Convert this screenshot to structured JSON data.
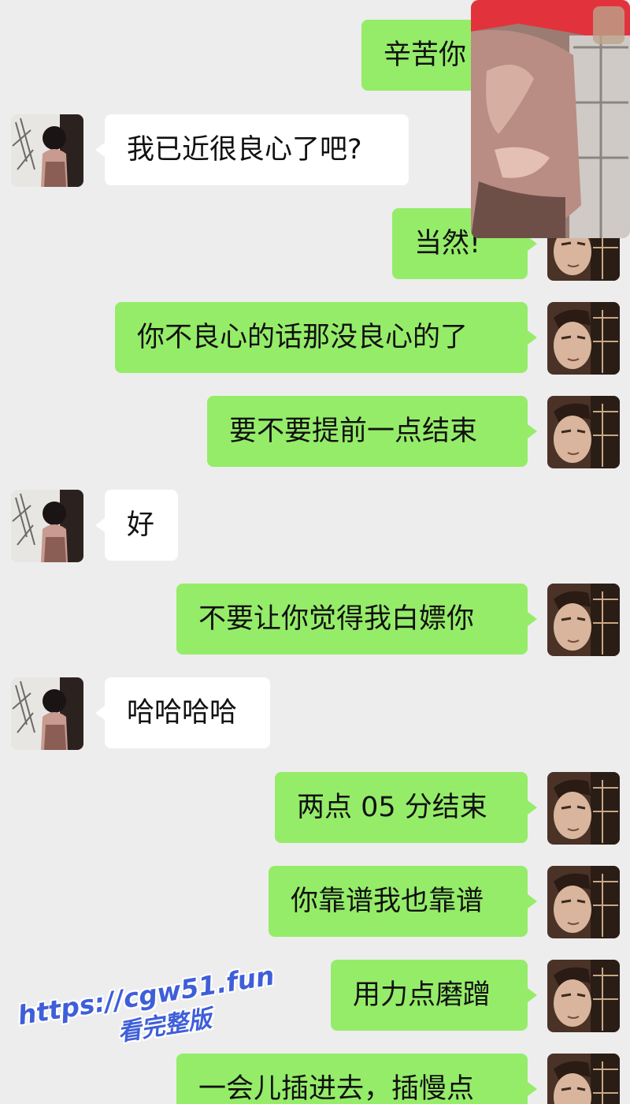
{
  "messages": [
    {
      "sender": "self",
      "text": "辛苦你"
    },
    {
      "sender": "other",
      "text": "我已近很良心了吧?"
    },
    {
      "sender": "self",
      "text": "当然!"
    },
    {
      "sender": "self",
      "text": "你不良心的话那没良心的了"
    },
    {
      "sender": "self",
      "text": "要不要提前一点结束"
    },
    {
      "sender": "other",
      "text": "好"
    },
    {
      "sender": "self",
      "text": "不要让你觉得我白嫖你"
    },
    {
      "sender": "other",
      "text": "哈哈哈哈"
    },
    {
      "sender": "self",
      "text": "两点 05 分结束"
    },
    {
      "sender": "self",
      "text": "你靠谱我也靠谱"
    },
    {
      "sender": "self",
      "text": "用力点磨蹭"
    },
    {
      "sender": "self",
      "text": "一会儿插进去，插慢点"
    }
  ],
  "watermark": {
    "url": "https://cgw51.fun",
    "subtitle": "看完整版"
  },
  "colors": {
    "background": "#ededed",
    "self_bubble": "#95ec69",
    "other_bubble": "#ffffff",
    "watermark": "#3f5fd8"
  }
}
